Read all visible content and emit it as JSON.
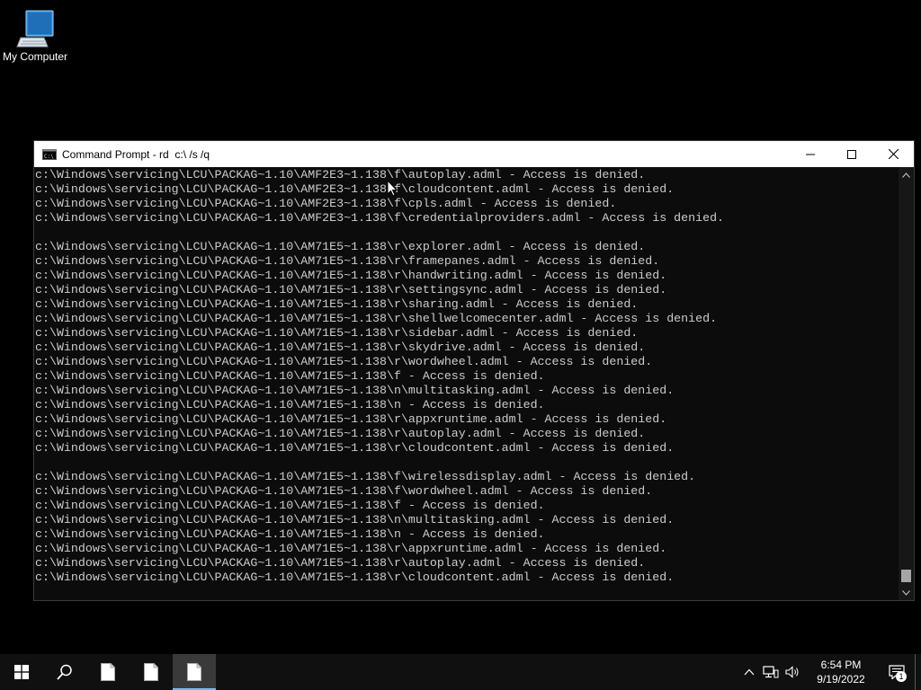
{
  "desktop": {
    "icons": [
      {
        "label": "My Computer",
        "icon": "computer-icon"
      }
    ]
  },
  "window": {
    "title": "Command Prompt - rd  c:\\ /s /q",
    "controls": {
      "minimize": "minimize-icon",
      "maximize": "maximize-icon",
      "close": "close-icon"
    },
    "console_lines": [
      "c:\\Windows\\servicing\\LCU\\PACKAG~1.10\\AMF2E3~1.138\\f\\autoplay.adml - Access is denied.",
      "c:\\Windows\\servicing\\LCU\\PACKAG~1.10\\AMF2E3~1.138\\f\\cloudcontent.adml - Access is denied.",
      "c:\\Windows\\servicing\\LCU\\PACKAG~1.10\\AMF2E3~1.138\\f\\cpls.adml - Access is denied.",
      "c:\\Windows\\servicing\\LCU\\PACKAG~1.10\\AMF2E3~1.138\\f\\credentialproviders.adml - Access is denied.",
      "",
      "c:\\Windows\\servicing\\LCU\\PACKAG~1.10\\AM71E5~1.138\\r\\explorer.adml - Access is denied.",
      "c:\\Windows\\servicing\\LCU\\PACKAG~1.10\\AM71E5~1.138\\r\\framepanes.adml - Access is denied.",
      "c:\\Windows\\servicing\\LCU\\PACKAG~1.10\\AM71E5~1.138\\r\\handwriting.adml - Access is denied.",
      "c:\\Windows\\servicing\\LCU\\PACKAG~1.10\\AM71E5~1.138\\r\\settingsync.adml - Access is denied.",
      "c:\\Windows\\servicing\\LCU\\PACKAG~1.10\\AM71E5~1.138\\r\\sharing.adml - Access is denied.",
      "c:\\Windows\\servicing\\LCU\\PACKAG~1.10\\AM71E5~1.138\\r\\shellwelcomecenter.adml - Access is denied.",
      "c:\\Windows\\servicing\\LCU\\PACKAG~1.10\\AM71E5~1.138\\r\\sidebar.adml - Access is denied.",
      "c:\\Windows\\servicing\\LCU\\PACKAG~1.10\\AM71E5~1.138\\r\\skydrive.adml - Access is denied.",
      "c:\\Windows\\servicing\\LCU\\PACKAG~1.10\\AM71E5~1.138\\r\\wordwheel.adml - Access is denied.",
      "c:\\Windows\\servicing\\LCU\\PACKAG~1.10\\AM71E5~1.138\\f - Access is denied.",
      "c:\\Windows\\servicing\\LCU\\PACKAG~1.10\\AM71E5~1.138\\n\\multitasking.adml - Access is denied.",
      "c:\\Windows\\servicing\\LCU\\PACKAG~1.10\\AM71E5~1.138\\n - Access is denied.",
      "c:\\Windows\\servicing\\LCU\\PACKAG~1.10\\AM71E5~1.138\\r\\appxruntime.adml - Access is denied.",
      "c:\\Windows\\servicing\\LCU\\PACKAG~1.10\\AM71E5~1.138\\r\\autoplay.adml - Access is denied.",
      "c:\\Windows\\servicing\\LCU\\PACKAG~1.10\\AM71E5~1.138\\r\\cloudcontent.adml - Access is denied.",
      "",
      "c:\\Windows\\servicing\\LCU\\PACKAG~1.10\\AM71E5~1.138\\f\\wirelessdisplay.adml - Access is denied.",
      "c:\\Windows\\servicing\\LCU\\PACKAG~1.10\\AM71E5~1.138\\f\\wordwheel.adml - Access is denied.",
      "c:\\Windows\\servicing\\LCU\\PACKAG~1.10\\AM71E5~1.138\\f - Access is denied.",
      "c:\\Windows\\servicing\\LCU\\PACKAG~1.10\\AM71E5~1.138\\n\\multitasking.adml - Access is denied.",
      "c:\\Windows\\servicing\\LCU\\PACKAG~1.10\\AM71E5~1.138\\n - Access is denied.",
      "c:\\Windows\\servicing\\LCU\\PACKAG~1.10\\AM71E5~1.138\\r\\appxruntime.adml - Access is denied.",
      "c:\\Windows\\servicing\\LCU\\PACKAG~1.10\\AM71E5~1.138\\r\\autoplay.adml - Access is denied.",
      "c:\\Windows\\servicing\\LCU\\PACKAG~1.10\\AM71E5~1.138\\r\\cloudcontent.adml - Access is denied."
    ],
    "scroll_position": 0.98
  },
  "taskbar": {
    "buttons": [
      {
        "name": "start-button",
        "icon": "windows-logo-icon"
      },
      {
        "name": "search-button",
        "icon": "search-icon"
      },
      {
        "name": "taskbar-app-1",
        "icon": "document-icon"
      },
      {
        "name": "taskbar-app-2",
        "icon": "document-icon"
      },
      {
        "name": "taskbar-app-3",
        "icon": "document-icon",
        "active": true
      }
    ],
    "tray": {
      "icons": [
        "chevron-up-icon",
        "network-icon",
        "volume-icon"
      ],
      "time": "6:54 PM",
      "date": "9/19/2022",
      "notification_count": "1"
    }
  },
  "colors": {
    "console_bg": "#0c0c0c",
    "console_text": "#cccccc",
    "taskbar_bg": "#101010",
    "accent": "#76b9ed"
  }
}
